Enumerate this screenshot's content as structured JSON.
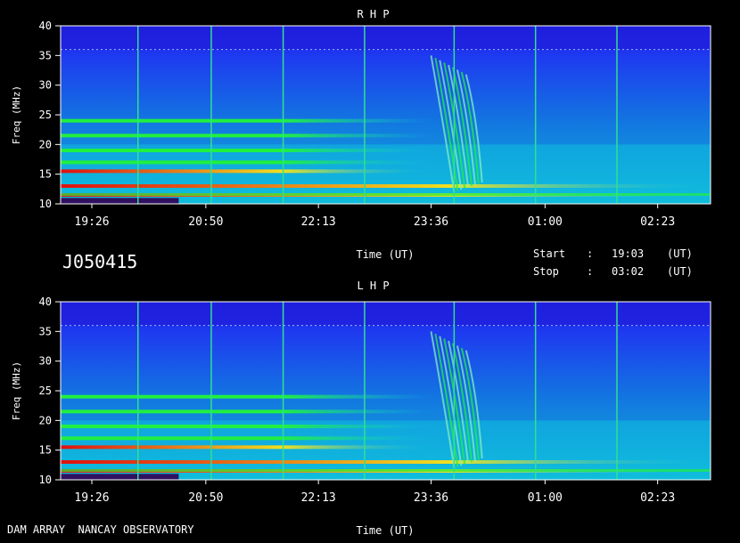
{
  "observation_id": "J050415",
  "footer_label": "DAM ARRAY  NANCAY OBSERVATORY",
  "time_info": {
    "start_label": "Start",
    "start_sep": ":",
    "start_value": "19:03",
    "start_unit": "(UT)",
    "stop_label": "Stop",
    "stop_sep": ":",
    "stop_value": "03:02",
    "stop_unit": "(UT)"
  },
  "colors": {
    "background": "#000000",
    "low": "#1432e6",
    "mid": "#10c8e0",
    "high": "#20f040",
    "peak": "#e01010",
    "marker": "#30e090"
  },
  "chart_data": [
    {
      "type": "heatmap",
      "title": "R H P",
      "xlabel": "Time (UT)",
      "ylabel": "Freq (MHz)",
      "x_ticks": [
        "19:26",
        "20:50",
        "22:13",
        "23:36",
        "01:00",
        "02:23"
      ],
      "y_ticks": [
        10,
        15,
        20,
        25,
        30,
        35,
        40
      ],
      "ylim": [
        10,
        40
      ],
      "time_range": [
        "19:03",
        "03:02"
      ],
      "vertical_markers": [
        "20:00",
        "20:54",
        "21:47",
        "22:47",
        "23:53",
        "00:53",
        "01:53"
      ],
      "intense_bands_mhz": [
        11.5,
        13,
        15.5,
        17,
        19,
        21.5,
        24
      ],
      "burst": {
        "start": "23:36",
        "end": "00:05",
        "freq_low": 12,
        "freq_high": 35
      }
    },
    {
      "type": "heatmap",
      "title": "L H P",
      "xlabel": "Time (UT)",
      "ylabel": "Freq (MHz)",
      "x_ticks": [
        "19:26",
        "20:50",
        "22:13",
        "23:36",
        "01:00",
        "02:23"
      ],
      "y_ticks": [
        10,
        15,
        20,
        25,
        30,
        35,
        40
      ],
      "ylim": [
        10,
        40
      ],
      "time_range": [
        "19:03",
        "03:02"
      ],
      "vertical_markers": [
        "20:00",
        "20:54",
        "21:47",
        "22:47",
        "23:53",
        "00:53",
        "01:53"
      ],
      "intense_bands_mhz": [
        11.5,
        13,
        15.5,
        17,
        19,
        21.5,
        24
      ],
      "burst": {
        "start": "23:36",
        "end": "00:05",
        "freq_low": 12,
        "freq_high": 35
      }
    }
  ]
}
